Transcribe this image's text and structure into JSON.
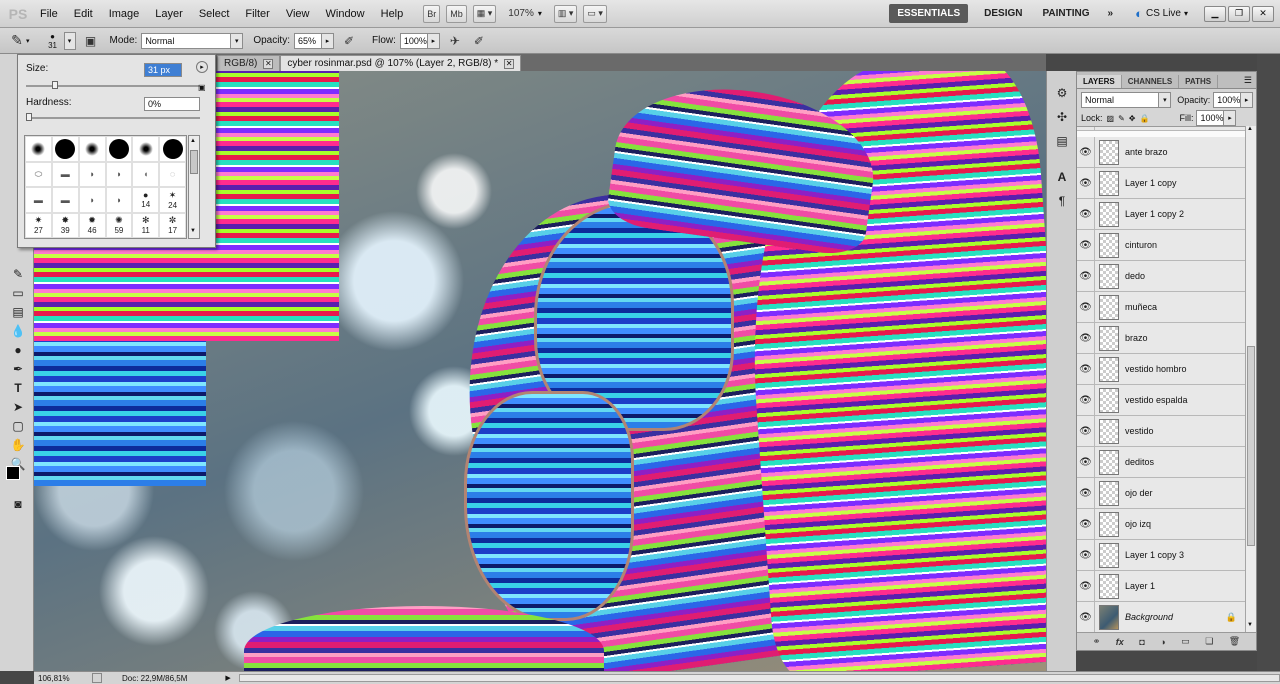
{
  "app": {
    "logo": "PS"
  },
  "menu": [
    "File",
    "Edit",
    "Image",
    "Layer",
    "Select",
    "Filter",
    "View",
    "Window",
    "Help"
  ],
  "appbar": {
    "bridge": "Br",
    "minibridge": "Mb",
    "zoom": "107%"
  },
  "workspaces": {
    "essentials": "ESSENTIALS",
    "design": "DESIGN",
    "painting": "PAINTING",
    "more": "»"
  },
  "cslive": "CS Live",
  "options": {
    "brush_size": "31",
    "mode_label": "Mode:",
    "mode_value": "Normal",
    "opacity_label": "Opacity:",
    "opacity_value": "65%",
    "flow_label": "Flow:",
    "flow_value": "100%"
  },
  "tabs": [
    {
      "label": "RGB/8)"
    },
    {
      "label": "cyber rosinmar.psd @ 107% (Layer 2, RGB/8) *"
    }
  ],
  "brush_popup": {
    "size_label": "Size:",
    "size_value": "31 px",
    "hardness_label": "Hardness:",
    "hardness_value": "0%",
    "brush_numbers": [
      "14",
      "24",
      "27",
      "39",
      "46",
      "59",
      "11",
      "17"
    ]
  },
  "layers_panel": {
    "tabs": [
      "LAYERS",
      "CHANNELS",
      "PATHS"
    ],
    "blend_mode": "Normal",
    "opacity_label": "Opacity:",
    "opacity_value": "100%",
    "lock_label": "Lock:",
    "fill_label": "Fill:",
    "fill_value": "100%",
    "layers": [
      {
        "name": "ante brazo"
      },
      {
        "name": "Layer 1 copy"
      },
      {
        "name": "Layer 1 copy 2"
      },
      {
        "name": "cinturon"
      },
      {
        "name": "dedo"
      },
      {
        "name": "muñeca"
      },
      {
        "name": "brazo"
      },
      {
        "name": "vestido hombro"
      },
      {
        "name": "vestido espalda"
      },
      {
        "name": "vestido"
      },
      {
        "name": "deditos"
      },
      {
        "name": "ojo der"
      },
      {
        "name": "ojo izq"
      },
      {
        "name": "Layer 1 copy 3"
      },
      {
        "name": "Layer 1"
      },
      {
        "name": "Background"
      }
    ],
    "footer_icons": [
      "link-icon",
      "fx-icon",
      "mask-icon",
      "adjustment-icon",
      "group-icon",
      "new-layer-icon",
      "trash-icon"
    ]
  },
  "status": {
    "zoom": "106,81%",
    "doc": "Doc: 22,9M/86,5M"
  },
  "colors": {
    "accent_selected": "#3f7fd4",
    "workspace_active": "#5a5a5a"
  }
}
